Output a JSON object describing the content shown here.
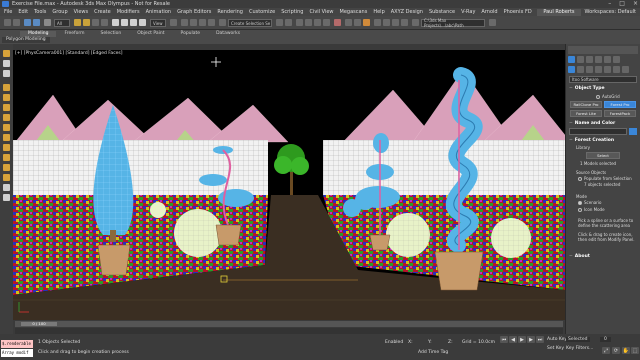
{
  "window": {
    "title": "Exercise File.max - Autodesk 3ds Max Olympus - Not for Resale"
  },
  "menu": [
    "File",
    "Edit",
    "Tools",
    "Group",
    "Views",
    "Create",
    "Modifiers",
    "Animation",
    "Graph Editors",
    "Rendering",
    "Customize",
    "Scripting",
    "Civil View",
    "Megascans",
    "Help",
    "AXYZ Design",
    "Substance",
    "V-Ray",
    "Arnold",
    "Phoenix FD"
  ],
  "menu_right": {
    "user": "Paul Roberts",
    "workspaces": "Workspaces: Default"
  },
  "toolbar": {
    "selection_set": "Create Selection Se",
    "projects_path": "C:\\3ds Max Projects\\...\\abc\\Path"
  },
  "ribbon": {
    "tabs": [
      "Modeling",
      "Freeform",
      "Selection",
      "Object Paint",
      "Populate",
      "Dataworks"
    ],
    "active": "Modeling",
    "sub_label": "Polygon Modeling"
  },
  "viewport": {
    "label": "[+] [PhysCamera001] [Standard] [Edged Faces]"
  },
  "command_panel": {
    "category": "Itoo Software",
    "object_type_header": "Object Type",
    "autogrid": "AutoGrid",
    "buttons_row1": [
      "RailClone Pro",
      "Forest Pro"
    ],
    "buttons_row2": [
      "Forest Lite",
      "ForestPack"
    ],
    "name_header": "Name and Color",
    "forest_creation_header": "Forest Creation",
    "library_label": "Library",
    "select_btn": "Select",
    "models_selected": "1 Models selected",
    "source_objects": "Source Objects",
    "populate_label": "Populate from Selection",
    "objects_selected": "7 objects selected",
    "mode_label": "Mode",
    "mode_options": [
      "Scenario",
      "Icon Mode"
    ],
    "help_text": [
      "Pick a spline or a surface to",
      "define the scattering area",
      "Click & drag to create icon,",
      "then edit from Modify Panel."
    ],
    "about_header": "About"
  },
  "timeline": {
    "frame": "0 / 100"
  },
  "status": {
    "listener1": "$.renderable",
    "listener2": "Array modif",
    "objects_selected": "1 Objects Selected",
    "prompt": "Click and drag to begin creation process",
    "add_time_tag": "Add Time Tag",
    "grid": "Grid = 10.0cm",
    "auto_key": "Auto Key",
    "selected": "Selected",
    "set_key": "Set Key",
    "key_filters": "Key Filters...",
    "frame_value": "0",
    "enabled": "Enabled",
    "coords": {
      "x": "X:",
      "y": "Y:",
      "z": "Z:"
    }
  },
  "colors": {
    "accent": "#3a86d8",
    "sky": "#000000",
    "ground": "#3a2e22",
    "wireframe": "#8fd3ff"
  }
}
